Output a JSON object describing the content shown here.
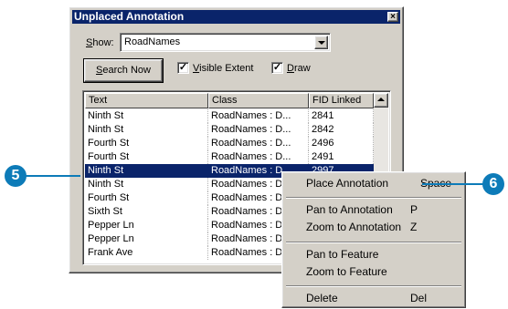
{
  "colors": {
    "titlebar": "#0a246a",
    "selection": "#0a246a",
    "callout": "#0d7bb8",
    "face": "#d4d0c8"
  },
  "dialog": {
    "title": "Unplaced Annotation",
    "close_icon": "close-icon",
    "show_label_u": "S",
    "show_label_rest": "how:",
    "show_value": "RoadNames",
    "search_u": "S",
    "search_rest": "earch Now",
    "visible_extent": {
      "checked": true,
      "u": "V",
      "rest": "isible Extent"
    },
    "draw": {
      "checked": true,
      "u": "D",
      "rest": "raw"
    },
    "check_glyph": "✓"
  },
  "table": {
    "columns": [
      "Text",
      "Class",
      "FID Linked"
    ],
    "rows": [
      [
        "Ninth St",
        "RoadNames : D...",
        "2841"
      ],
      [
        "Ninth St",
        "RoadNames : D...",
        "2842"
      ],
      [
        "Fourth St",
        "RoadNames : D...",
        "2496"
      ],
      [
        "Fourth St",
        "RoadNames : D...",
        "2491"
      ],
      [
        "Ninth St",
        "RoadNames : D",
        "2997"
      ],
      [
        "Ninth St",
        "RoadNames : D",
        ""
      ],
      [
        "Fourth St",
        "RoadNames : D",
        ""
      ],
      [
        "Sixth St",
        "RoadNames : D",
        ""
      ],
      [
        "Pepper Ln",
        "RoadNames : D",
        ""
      ],
      [
        "Pepper Ln",
        "RoadNames : D",
        ""
      ],
      [
        "Frank Ave",
        "RoadNames : D",
        ""
      ]
    ],
    "selected_row": 4
  },
  "context_menu": {
    "items": [
      {
        "label": "Place Annotation",
        "accel": "Space"
      },
      {
        "label": "Pan to Annotation",
        "accel": "P"
      },
      {
        "label": "Zoom to Annotation",
        "accel": "Z"
      },
      {
        "label": "Pan to Feature",
        "accel": ""
      },
      {
        "label": "Zoom to Feature",
        "accel": ""
      },
      {
        "label": "Delete",
        "accel": "Del"
      }
    ]
  },
  "callouts": {
    "left": "5",
    "right": "6"
  }
}
